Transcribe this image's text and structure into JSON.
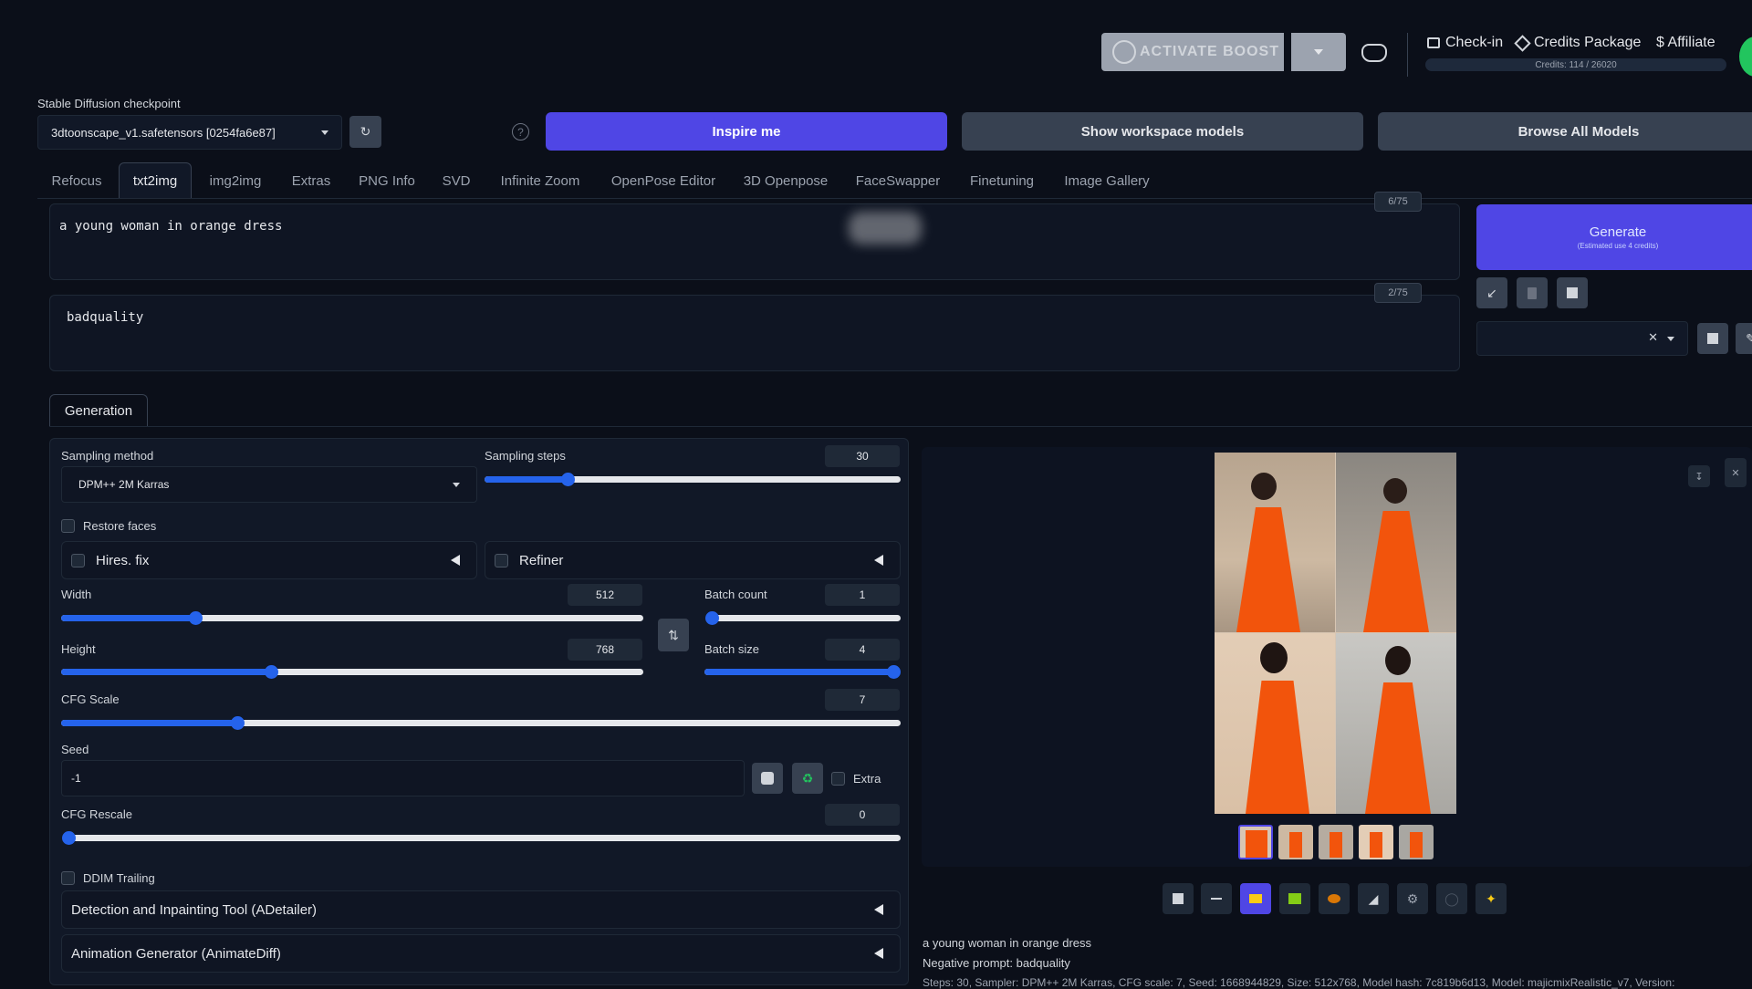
{
  "header": {
    "activate_boost": "ACTIVATE BOOST",
    "check_in": "Check-in",
    "credits_package": "Credits Package",
    "affiliate": "$ Affiliate",
    "credits_text": "Credits: 114 / 26020"
  },
  "checkpoint": {
    "label": "Stable Diffusion checkpoint",
    "value": "3dtoonscape_v1.safetensors [0254fa6e87]"
  },
  "actions": {
    "inspire": "Inspire me",
    "workspace": "Show workspace models",
    "browse": "Browse All Models"
  },
  "tabs": [
    "Refocus",
    "txt2img",
    "img2img",
    "Extras",
    "PNG Info",
    "SVD",
    "Infinite Zoom",
    "OpenPose Editor",
    "3D Openpose",
    "FaceSwapper",
    "Finetuning",
    "Image Gallery"
  ],
  "prompt": {
    "positive": "a young woman in orange dress",
    "positive_count": "6/75",
    "negative": "badquality",
    "negative_count": "2/75"
  },
  "generate": {
    "label": "Generate",
    "sub": "(Estimated use 4 credits)"
  },
  "generation_tab": "Generation",
  "settings": {
    "sampling_method_label": "Sampling method",
    "sampling_method": "DPM++ 2M Karras",
    "sampling_steps_label": "Sampling steps",
    "sampling_steps": "30",
    "restore_faces": "Restore faces",
    "hires_fix": "Hires. fix",
    "refiner": "Refiner",
    "width_label": "Width",
    "width": "512",
    "height_label": "Height",
    "height": "768",
    "batch_count_label": "Batch count",
    "batch_count": "1",
    "batch_size_label": "Batch size",
    "batch_size": "4",
    "cfg_label": "CFG Scale",
    "cfg": "7",
    "seed_label": "Seed",
    "seed": "-1",
    "extra": "Extra",
    "cfg_rescale_label": "CFG Rescale",
    "cfg_rescale": "0",
    "ddim": "DDIM Trailing",
    "adetailer": "Detection and Inpainting Tool (ADetailer)",
    "animatediff": "Animation Generator (AnimateDiff)"
  },
  "sliders": {
    "sampling_steps": 0.2,
    "width": 0.23,
    "height": 0.36,
    "batch_count": 0.0,
    "batch_size": 1.0,
    "cfg": 0.21,
    "cfg_rescale": 0.0
  },
  "output": {
    "line1": "a young woman in orange dress",
    "line2": "Negative prompt: badquality",
    "line3": "Steps: 30, Sampler: DPM++ 2M Karras, CFG scale: 7, Seed: 1668944829, Size: 512x768, Model hash: 7c819b6d13, Model: majicmixRealistic_v7, Version:"
  },
  "colors": {
    "accent": "#4f46e5",
    "background": "#0b0f19",
    "dress": "#f2540c"
  }
}
